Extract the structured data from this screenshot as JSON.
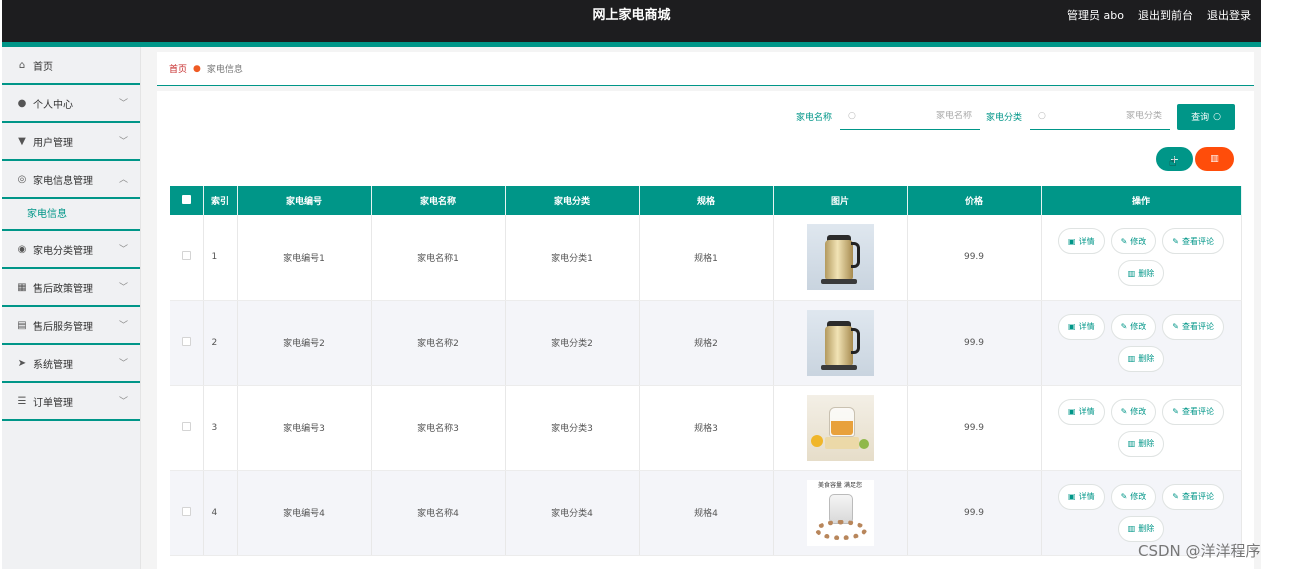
{
  "header": {
    "title": "网上家电商城",
    "user_label": "管理员 abo",
    "to_front_label": "退出到前台",
    "logout_label": "退出登录"
  },
  "sidebar": {
    "items": [
      {
        "label": "首页",
        "icon": "home-icon"
      },
      {
        "label": "个人中心",
        "icon": "user-icon"
      },
      {
        "label": "用户管理",
        "icon": "user-manage-icon"
      },
      {
        "label": "家电信息管理",
        "icon": "info-icon",
        "sub": "家电信息"
      },
      {
        "label": "家电分类管理",
        "icon": "category-icon"
      },
      {
        "label": "售后政策管理",
        "icon": "grid-icon"
      },
      {
        "label": "售后服务管理",
        "icon": "document-icon"
      },
      {
        "label": "系统管理",
        "icon": "send-icon"
      },
      {
        "label": "订单管理",
        "icon": "sliders-icon"
      }
    ]
  },
  "breadcrumb": {
    "home": "首页",
    "current": "家电信息"
  },
  "search": {
    "name_label": "家电名称",
    "name_placeholder": "家电名称",
    "category_label": "家电分类",
    "category_placeholder": "家电分类",
    "query_label": "查询"
  },
  "actions": {
    "add_label": "+",
    "delete_icon": "trash-icon"
  },
  "table": {
    "columns": [
      "索引",
      "家电编号",
      "家电名称",
      "家电分类",
      "规格",
      "图片",
      "价格",
      "操作"
    ],
    "ops": {
      "detail": "详情",
      "edit": "修改",
      "comments": "查看评论",
      "delete": "删除"
    },
    "rows": [
      {
        "index": "1",
        "code": "家电编号1",
        "name": "家电名称1",
        "category": "家电分类1",
        "spec": "规格1",
        "image": "kettle",
        "price": "99.9"
      },
      {
        "index": "2",
        "code": "家电编号2",
        "name": "家电名称2",
        "category": "家电分类2",
        "spec": "规格2",
        "image": "kettle",
        "price": "99.9"
      },
      {
        "index": "3",
        "code": "家电编号3",
        "name": "家电名称3",
        "category": "家电分类3",
        "spec": "规格3",
        "image": "tea-pot",
        "price": "99.9"
      },
      {
        "index": "4",
        "code": "家电编号4",
        "name": "家电名称4",
        "category": "家电分类4",
        "spec": "规格4",
        "image": "slow-cooker",
        "price": "99.9"
      }
    ],
    "cooker_caption": "美食容量 满足您"
  },
  "watermark": "CSDN @洋洋程序",
  "colors": {
    "accent": "#009688",
    "danger": "#ff4d0a",
    "header_bg": "#1d1d1f"
  }
}
